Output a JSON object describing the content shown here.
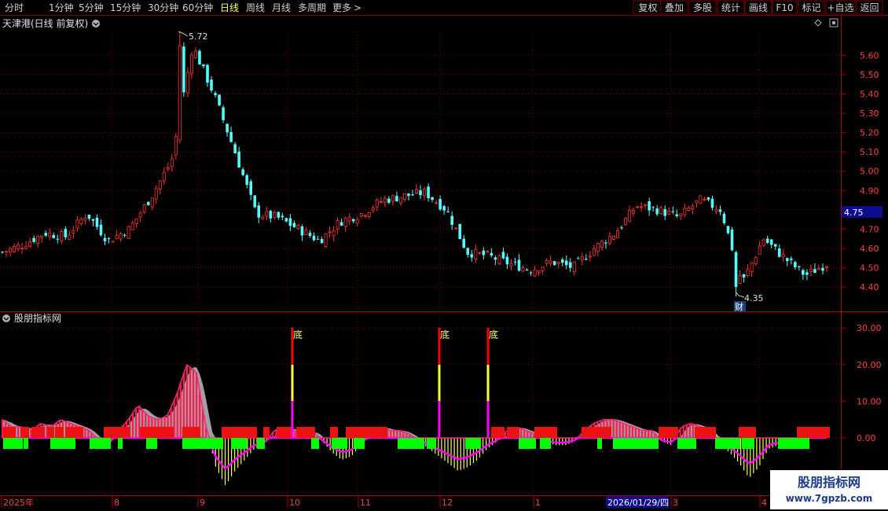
{
  "toolbar": {
    "periods": [
      "分时",
      "1分钟",
      "5分钟",
      "15分钟",
      "30分钟",
      "60分钟",
      "日线",
      "周线",
      "月线",
      "多周期",
      "更多"
    ],
    "active_period": "日线",
    "more_arrow": ">",
    "right_buttons": [
      "复权",
      "叠加",
      "多股",
      "统计",
      "画线",
      "F10",
      "标记",
      "+自选",
      "返回"
    ]
  },
  "main_panel": {
    "title": "天津港(日线 前复权)",
    "high_label": "5.72",
    "low_label": "4.35",
    "current_price": "4.75",
    "cai_badge": "财"
  },
  "indicator_panel": {
    "title": "股朋指标网",
    "di_label": "底"
  },
  "x_axis": {
    "labels": [
      "2025年",
      "8",
      "9",
      "10",
      "11",
      "12",
      "1",
      "3",
      "4"
    ],
    "highlight_date": "2026/01/29/四"
  },
  "watermark": {
    "name": "股朋指标网",
    "url": "www.7gpzb.com"
  },
  "colors": {
    "up": "#ff3232",
    "down": "#54fcfc",
    "grid": "#7a0000",
    "axis": "#b00000",
    "green_bar": "#00ff00",
    "magenta": "#ff00ff",
    "yellow": "#ffff55"
  },
  "chart_data": [
    {
      "type": "candlestick",
      "ylim": [
        4.35,
        5.8
      ],
      "yticks": [
        "5.60",
        "5.50",
        "5.40",
        "5.30",
        "5.20",
        "5.10",
        "5.00",
        "4.90",
        "4.80",
        "4.70",
        "4.60",
        "4.50",
        "4.40"
      ],
      "x": [
        "2025-07-01",
        "2025-07-08",
        "2025-07-15",
        "2025-07-22",
        "2025-07-29",
        "2025-08-05",
        "2025-08-12",
        "2025-08-19",
        "2025-08-26",
        "2025-08-29",
        "2025-09-03",
        "2025-09-10",
        "2025-09-17",
        "2025-09-24",
        "2025-10-10",
        "2025-10-17",
        "2025-10-24",
        "2025-10-31",
        "2025-11-07",
        "2025-11-14",
        "2025-11-21",
        "2025-11-28",
        "2025-12-05",
        "2025-12-12",
        "2025-12-19",
        "2025-12-26",
        "2026-01-05",
        "2026-01-12",
        "2026-01-19",
        "2026-01-26",
        "2026-02-02",
        "2026-02-09",
        "2026-03-02",
        "2026-03-09",
        "2026-03-16",
        "2026-03-20",
        "2026-03-27",
        "2026-04-03",
        "2026-04-10",
        "2026-04-17"
      ],
      "close": [
        4.58,
        4.62,
        4.68,
        4.66,
        4.78,
        4.64,
        4.7,
        4.86,
        5.05,
        5.65,
        5.4,
        5.1,
        4.78,
        4.76,
        4.7,
        4.64,
        4.74,
        4.78,
        4.85,
        4.87,
        4.89,
        4.8,
        4.58,
        4.56,
        4.52,
        4.49,
        4.53,
        4.5,
        4.6,
        4.68,
        4.82,
        4.8,
        4.76,
        4.85,
        4.8,
        4.42,
        4.65,
        4.55,
        4.46,
        4.52
      ],
      "high_low_range": [
        4.35,
        5.72
      ],
      "current": 4.75
    },
    {
      "type": "bar",
      "ylim": [
        -12,
        30
      ],
      "yticks": [
        "30.00",
        "20.00",
        "10.00",
        "0.00"
      ],
      "signals": [
        {
          "x": "2025-10-09",
          "label": "底"
        },
        {
          "x": "2025-12-01",
          "label": "底"
        },
        {
          "x": "2025-12-19",
          "label": "底"
        }
      ],
      "values": [
        5,
        3,
        3,
        2,
        4,
        3,
        5,
        4,
        3,
        2,
        -1,
        -2,
        2,
        5,
        9,
        6,
        5,
        6,
        12,
        20,
        18,
        3,
        -8,
        -13,
        -9,
        -6,
        -3,
        -2,
        2,
        3,
        2,
        1,
        2,
        -1,
        -4,
        -6,
        -5,
        -2,
        1,
        3,
        2,
        2,
        1,
        -1,
        -3,
        -5,
        -7,
        -9,
        -8,
        -6,
        -3,
        -1,
        2,
        3,
        2,
        1,
        -1,
        -2,
        -2,
        -1,
        2,
        4,
        5,
        5,
        4,
        3,
        2,
        2,
        -1,
        -2,
        3,
        4,
        3,
        2,
        -2,
        -4,
        -7,
        -11,
        -8,
        -3,
        -2,
        -3,
        -1,
        1,
        2,
        2
      ]
    }
  ]
}
